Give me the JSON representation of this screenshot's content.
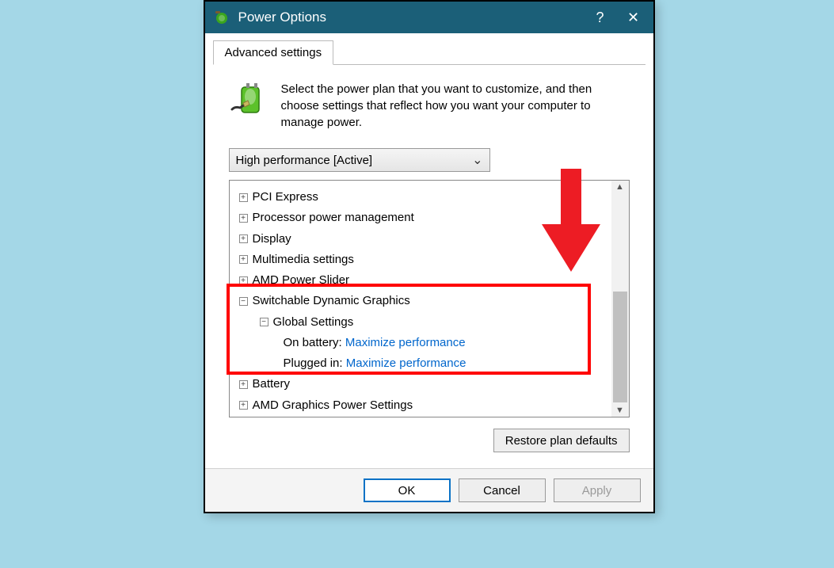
{
  "window": {
    "title": "Power Options",
    "help": "?",
    "close": "✕"
  },
  "tab": {
    "label": "Advanced settings"
  },
  "intro": "Select the power plan that you want to customize, and then choose settings that reflect how you want your computer to manage power.",
  "plan": {
    "selected": "High performance [Active]"
  },
  "tree": {
    "items": [
      {
        "label": "PCI Express",
        "expand": "+"
      },
      {
        "label": "Processor power management",
        "expand": "+"
      },
      {
        "label": "Display",
        "expand": "+"
      },
      {
        "label": "Multimedia settings",
        "expand": "+"
      },
      {
        "label": "AMD Power Slider",
        "expand": "+"
      },
      {
        "label": "Switchable Dynamic Graphics",
        "expand": "−"
      },
      {
        "label": "Global Settings",
        "expand": "−"
      },
      {
        "label_prefix": "On battery:",
        "value": "Maximize performance"
      },
      {
        "label_prefix": "Plugged in:",
        "value": "Maximize performance"
      },
      {
        "label": "Battery",
        "expand": "+"
      },
      {
        "label": "AMD Graphics Power Settings",
        "expand": "+"
      }
    ]
  },
  "restore": {
    "label": "Restore plan defaults"
  },
  "buttons": {
    "ok": "OK",
    "cancel": "Cancel",
    "apply": "Apply"
  }
}
